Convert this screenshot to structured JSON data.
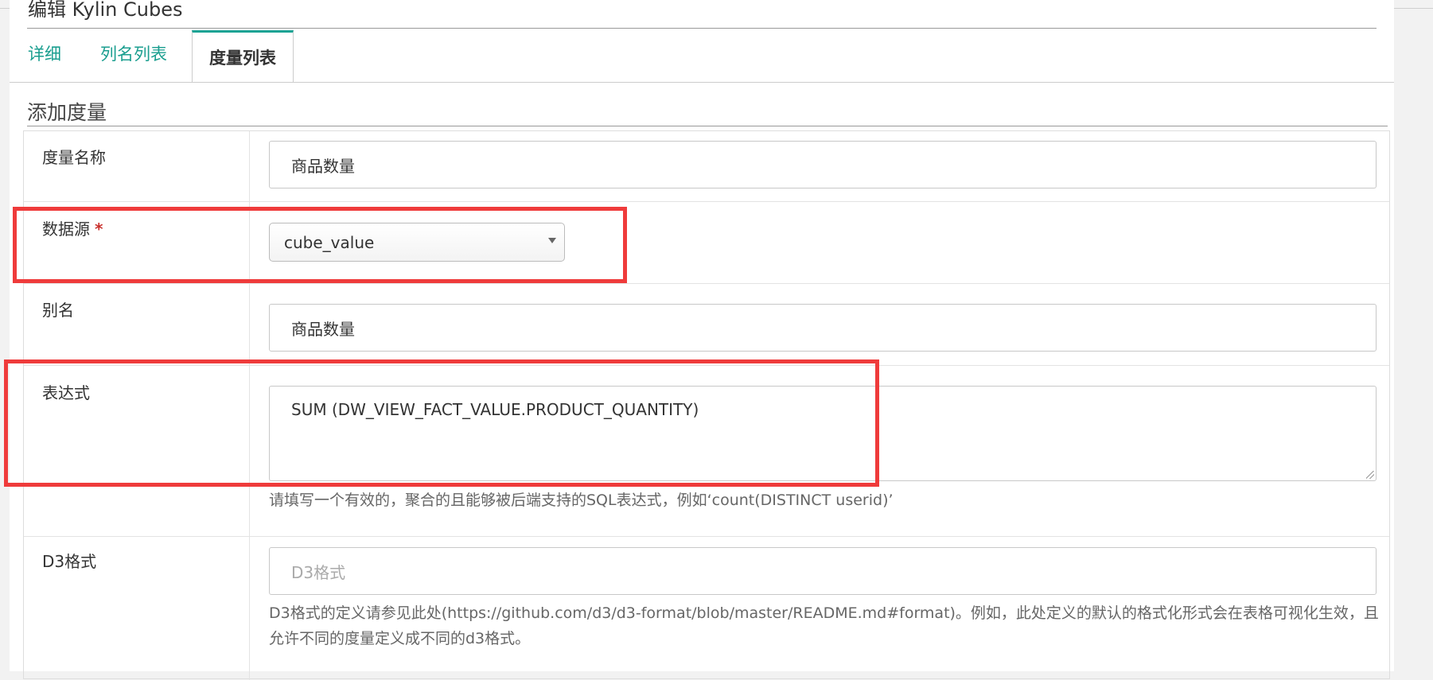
{
  "modal": {
    "title": "编辑 Kylin Cubes"
  },
  "tabs": [
    {
      "label": "详细"
    },
    {
      "label": "列名列表"
    },
    {
      "label": "度量列表"
    }
  ],
  "section": {
    "title": "添加度量"
  },
  "form": {
    "measure_name": {
      "label": "度量名称",
      "value": "商品数量"
    },
    "datasource": {
      "label": "数据源",
      "required_mark": "*",
      "selected": "cube_value"
    },
    "alias": {
      "label": "别名",
      "value": "商品数量"
    },
    "expression": {
      "label": "表达式",
      "value": "SUM (DW_VIEW_FACT_VALUE.PRODUCT_QUANTITY)",
      "help": "请填写一个有效的，聚合的且能够被后端支持的SQL表达式，例如‘count(DISTINCT userid)’"
    },
    "d3_format": {
      "label": "D3格式",
      "placeholder": "D3格式",
      "help": "D3格式的定义请参见此处(https://github.com/d3/d3-format/blob/master/README.md#format)。例如，此处定义的默认的格式化形式会在表格可视化生效，且允许不同的度量定义成不同的d3格式。"
    }
  },
  "colors": {
    "accent": "#1a9e8f",
    "highlight": "#ef3b3b",
    "required": "#c9302c"
  },
  "icons": {
    "select_caret": "caret-down-icon"
  }
}
